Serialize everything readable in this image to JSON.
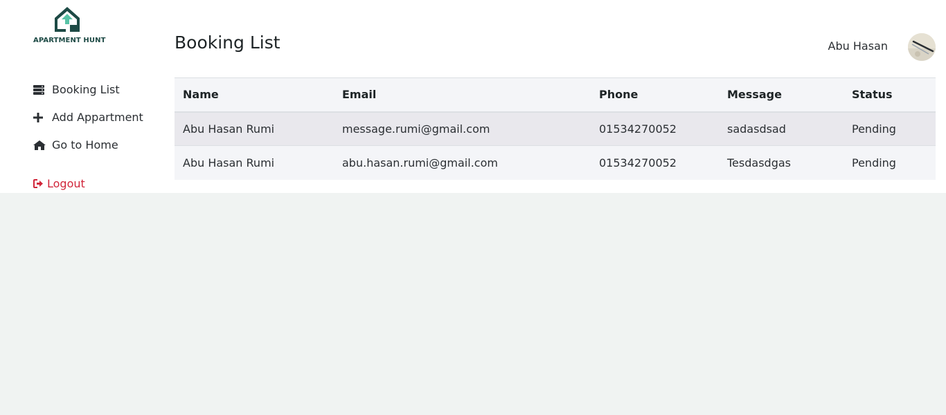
{
  "brand": {
    "name": "APARTMENT HUNT",
    "color": "#1d4a45",
    "accent": "#2f8b7a"
  },
  "sidebar": {
    "items": [
      {
        "label": "Booking List",
        "icon": "server-list-icon"
      },
      {
        "label": "Add Appartment",
        "icon": "plus-icon"
      },
      {
        "label": "Go to Home",
        "icon": "home-icon"
      }
    ],
    "logout": {
      "label": "Logout",
      "icon": "sign-out-icon",
      "color": "#d1263a"
    }
  },
  "header": {
    "title": "Booking List",
    "user_name": "Abu Hasan"
  },
  "table": {
    "columns": [
      "Name",
      "Email",
      "Phone",
      "Message",
      "Status"
    ],
    "rows": [
      [
        "Abu Hasan Rumi",
        "message.rumi@gmail.com",
        "01534270052",
        "sadasdsad",
        "Pending"
      ],
      [
        "Abu Hasan Rumi",
        "abu.hasan.rumi@gmail.com",
        "01534270052",
        "Tesdasdgas",
        "Pending"
      ]
    ]
  }
}
